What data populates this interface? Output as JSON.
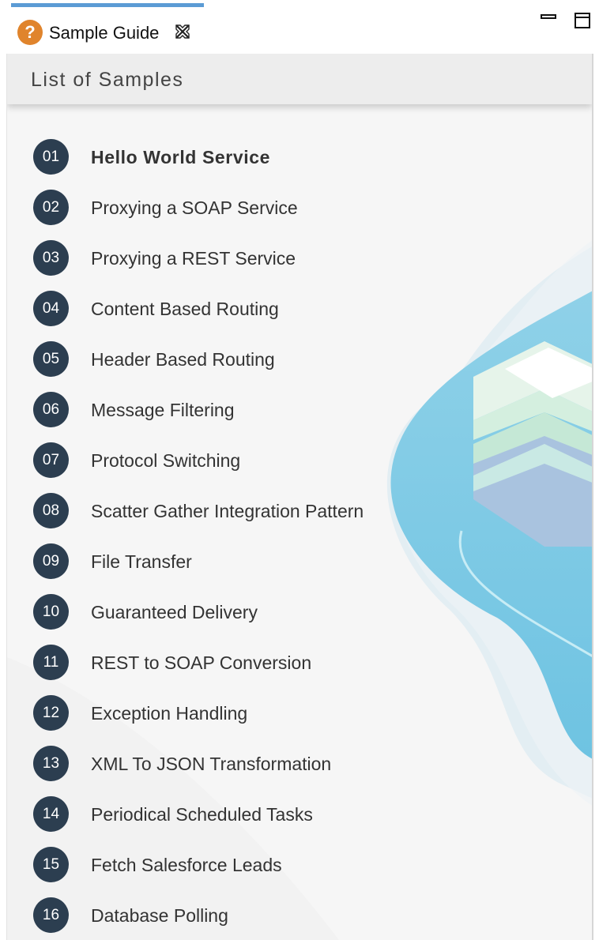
{
  "tab": {
    "title": "Sample Guide",
    "icon": "help-icon",
    "accent": "#5b9bd5",
    "icon_color": "#e0842c"
  },
  "window_controls": [
    "minimize-icon",
    "maximize-icon"
  ],
  "panel": {
    "title": "List of Samples",
    "number_badge_color": "#2c3e50"
  },
  "samples": [
    {
      "number": "01",
      "label": "Hello World Service",
      "selected": true
    },
    {
      "number": "02",
      "label": "Proxying a SOAP Service"
    },
    {
      "number": "03",
      "label": "Proxying a REST Service"
    },
    {
      "number": "04",
      "label": "Content Based Routing"
    },
    {
      "number": "05",
      "label": "Header Based Routing"
    },
    {
      "number": "06",
      "label": "Message Filtering"
    },
    {
      "number": "07",
      "label": "Protocol Switching"
    },
    {
      "number": "08",
      "label": "Scatter Gather Integration Pattern"
    },
    {
      "number": "09",
      "label": "File Transfer"
    },
    {
      "number": "10",
      "label": "Guaranteed Delivery"
    },
    {
      "number": "11",
      "label": "REST to SOAP Conversion"
    },
    {
      "number": "12",
      "label": "Exception Handling"
    },
    {
      "number": "13",
      "label": "XML To JSON Transformation"
    },
    {
      "number": "14",
      "label": "Periodical Scheduled Tasks"
    },
    {
      "number": "15",
      "label": "Fetch Salesforce Leads"
    },
    {
      "number": "16",
      "label": "Database Polling"
    }
  ]
}
